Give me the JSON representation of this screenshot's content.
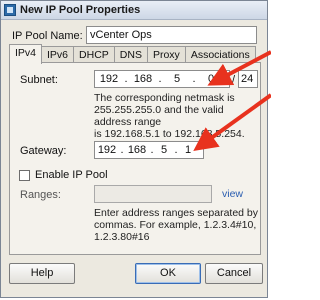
{
  "window": {
    "title": "New IP Pool Properties"
  },
  "pool_name": {
    "label": "IP Pool Name:",
    "value": "vCenter Ops"
  },
  "tabs": [
    {
      "label": "IPv4"
    },
    {
      "label": "IPv6"
    },
    {
      "label": "DHCP"
    },
    {
      "label": "DNS"
    },
    {
      "label": "Proxy"
    },
    {
      "label": "Associations"
    }
  ],
  "subnet": {
    "label": "Subnet:",
    "octets": [
      "192",
      "168",
      "5",
      "0"
    ],
    "prefix": "24",
    "note_line1": "The corresponding netmask is",
    "note_line2": "255.255.255.0 and the valid address range",
    "note_line3": "is 192.168.5.1 to 192.168.5.254."
  },
  "gateway": {
    "label": "Gateway:",
    "octets": [
      "192",
      "168",
      "5",
      "1"
    ]
  },
  "enable_pool": {
    "label": "Enable IP Pool",
    "checked": false
  },
  "ranges": {
    "label": "Ranges:",
    "value": "",
    "view_link": "view",
    "help_line1": "Enter address ranges separated by",
    "help_line2": "commas. For example, 1.2.3.4#10,",
    "help_line3": "1.2.3.80#16"
  },
  "buttons": {
    "help": "Help",
    "ok": "OK",
    "cancel": "Cancel"
  },
  "annotation_color": "#e8321e"
}
